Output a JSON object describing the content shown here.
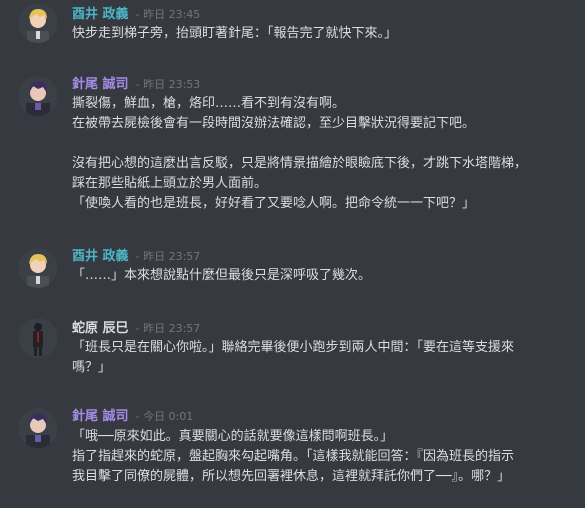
{
  "colors": {
    "background": "#36393f",
    "text": "#dcddde",
    "timestamp": "#72767d"
  },
  "messages": [
    {
      "author": "酉井 政義",
      "author_color": "#4db6c7",
      "timestamp": "- 昨日 23:45",
      "avatar_icon": "blonde-character-avatar-icon",
      "lines": [
        "快步走到梯子旁，抬頭盯著針尾：「報告完了就快下來。」"
      ]
    },
    {
      "author": "針尾 誠司",
      "author_color": "#a58ce8",
      "timestamp": "- 昨日 23:53",
      "avatar_icon": "purple-hair-character-avatar-icon",
      "lines": [
        "撕裂傷，鮮血，槍，烙印……看不到有沒有啊。",
        "在被帶去屍檢後會有一段時間沒辦法確認，至少目擊狀況得要記下吧。",
        "",
        "沒有把心想的這麼出言反駁，只是將情景描繪於眼瞼底下後，才跳下水塔階梯，",
        "踩在那些貼紙上頭立於男人面前。",
        "「使喚人看的也是班長，好好看了又要唸人啊。把命令統一一下吧？」"
      ]
    },
    {
      "author": "酉井 政義",
      "author_color": "#4db6c7",
      "timestamp": "- 昨日 23:57",
      "avatar_icon": "blonde-character-avatar-icon",
      "lines": [
        "「……」本來想說點什麼但最後只是深呼吸了幾次。"
      ]
    },
    {
      "author": "蛇原 辰巳",
      "author_color": "#dcddde",
      "timestamp": "- 昨日 23:57",
      "avatar_icon": "dark-standing-figure-avatar-icon",
      "lines": [
        "「班長只是在關心你啦。」聯絡完畢後便小跑步到兩人中間：「要在這等支援來",
        "嗎？」"
      ]
    },
    {
      "author": "針尾 誠司",
      "author_color": "#a58ce8",
      "timestamp": "- 今日 0:01",
      "avatar_icon": "purple-hair-character-avatar-icon",
      "lines": [
        "「哦──原來如此。真要關心的話就要像這樣問啊班長。」",
        "指了指趕來的蛇原，盤起胸來勾起嘴角。「這樣我就能回答：『因為班長的指示",
        "我目擊了同僚的屍體，所以想先回署裡休息，這裡就拜託你們了──』。哪？」"
      ]
    }
  ]
}
